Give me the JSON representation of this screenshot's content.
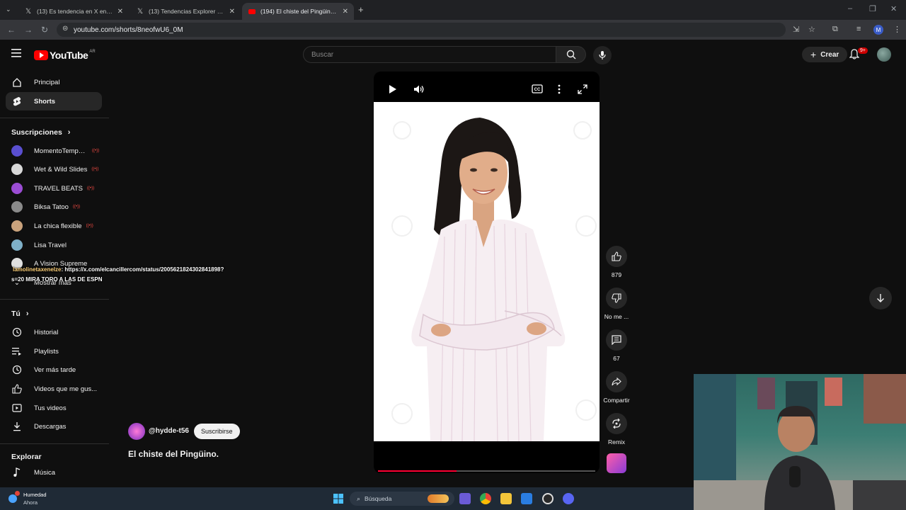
{
  "browser": {
    "tabs": [
      {
        "title": "(13) Es tendencia en X en X: \"#",
        "active": false
      },
      {
        "title": "(13) Tendencias Explorer en X: \"",
        "active": false
      },
      {
        "title": "(194) El chiste del Pingüino. - Y",
        "active": true
      }
    ],
    "url": "youtube.com/shorts/8neofwU6_0M",
    "profile_initial": "M"
  },
  "header": {
    "logo_text": "YouTube",
    "country_code": "AR",
    "search_placeholder": "Buscar",
    "create_label": "Crear",
    "notifications_badge": "9+"
  },
  "sidebar": {
    "main": [
      {
        "label": "Principal",
        "icon": "home-icon"
      },
      {
        "label": "Shorts",
        "icon": "shorts-icon",
        "selected": true
      }
    ],
    "subscriptions_heading": "Suscripciones",
    "subscriptions": [
      {
        "name": "MomentoTempu...",
        "color": "#5a4fd0"
      },
      {
        "name": "Wet & Wild Slides",
        "color": "#d8d8d8"
      },
      {
        "name": "TRAVEL BEATS",
        "color": "#9b4dd4"
      },
      {
        "name": "Biksa Tatoo",
        "color": "#8a8a8a"
      },
      {
        "name": "La chica flexible",
        "color": "#c9a27c"
      },
      {
        "name": "Lisa Travel",
        "color": "#7fb0c8"
      },
      {
        "name": "A Vision Supreme",
        "color": "#e0e0e0"
      }
    ],
    "show_more": "Mostrar más",
    "you_heading": "Tú",
    "you_items": [
      {
        "label": "Historial",
        "icon": "history-icon"
      },
      {
        "label": "Playlists",
        "icon": "playlists-icon"
      },
      {
        "label": "Ver más tarde",
        "icon": "watch-later-icon"
      },
      {
        "label": "Videos que me gus...",
        "icon": "liked-icon"
      },
      {
        "label": "Tus videos",
        "icon": "your-videos-icon"
      },
      {
        "label": "Descargas",
        "icon": "downloads-icon"
      }
    ],
    "explore_heading": "Explorar",
    "explore_items": [
      {
        "label": "Música",
        "icon": "music-icon"
      }
    ]
  },
  "overlay": {
    "user": "lamolinetaxenelze",
    "link": ": https://x.com/elcancillercom/status/2005621824302841898?",
    "line2": "s=20 MIRA TORO A LAS DE ESPN"
  },
  "short": {
    "like_count": "879",
    "dislike_label": "No me ...",
    "comments_count": "67",
    "share_label": "Compartir",
    "remix_label": "Remix",
    "progress": 0.36,
    "channel": "@hydde-t56",
    "subscribe_label": "Suscribirse",
    "title": "El chiste del Pingüino."
  },
  "taskbar": {
    "weather_title": "Humedad",
    "weather_sub": "Ahora",
    "search_placeholder": "Búsqueda"
  }
}
